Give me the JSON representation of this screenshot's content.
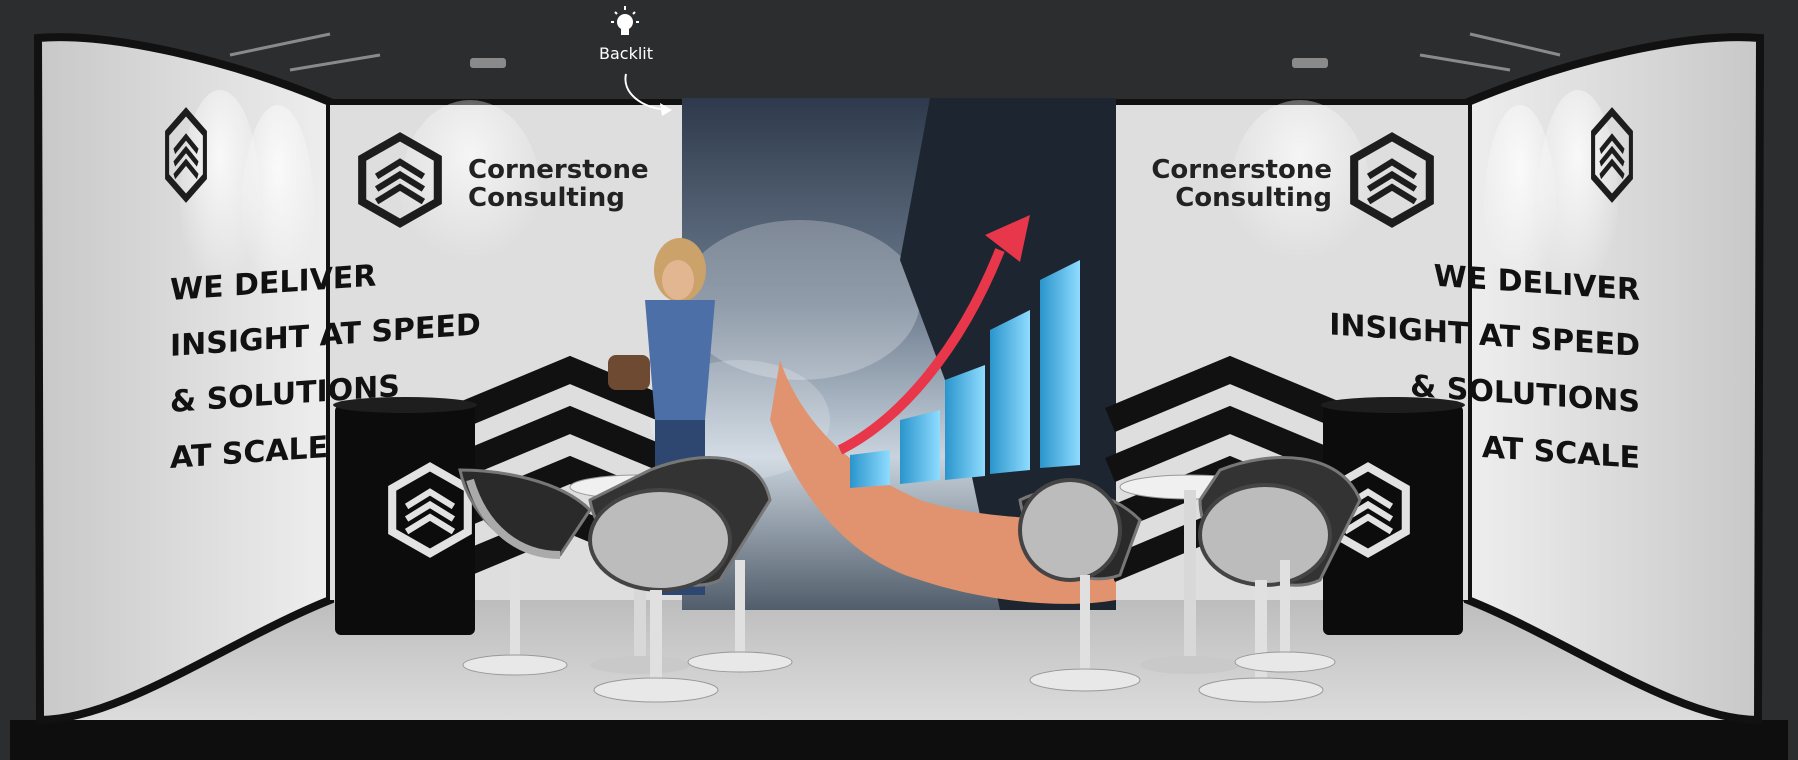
{
  "annotation": {
    "label": "Backlit",
    "icon": "lightbulb-icon"
  },
  "brand": {
    "line1": "Cornerstone",
    "line2": "Consulting"
  },
  "slogan": {
    "line1": "WE DELIVER",
    "line2": "INSIGHT AT SPEED",
    "line3": "& SOLUTIONS",
    "line4": "AT SCALE"
  },
  "colors": {
    "background": "#2b2d2f",
    "wall": "#e6e6e6",
    "accent_red": "#e8364a",
    "accent_blue": "#3db4e8"
  }
}
